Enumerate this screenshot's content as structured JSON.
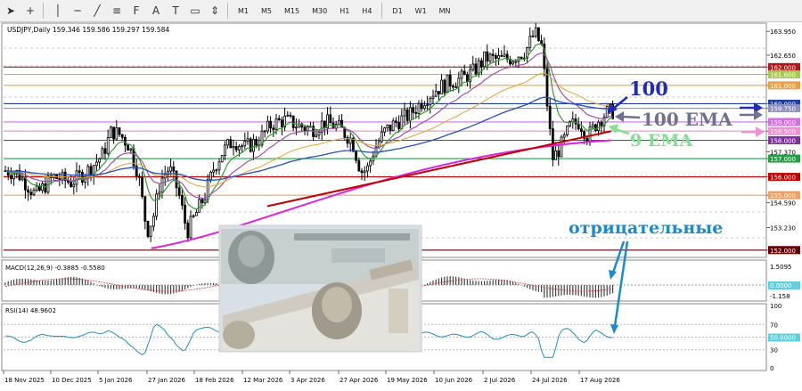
{
  "toolbar": {
    "timeframes": [
      "M1",
      "M5",
      "M15",
      "M30",
      "H1",
      "H4",
      "D1",
      "W1",
      "MN"
    ]
  },
  "chart": {
    "symbol_line": "USDJPY,Daily  159.346 159.586 159.297 159.584",
    "price_axis": [
      "163.950",
      "162.650",
      "162.000",
      "161.600",
      "161.000",
      "160.000",
      "159.750",
      "159.000",
      "158.500",
      "158.000",
      "157.370",
      "157.000",
      "156.000",
      "155.000",
      "154.590",
      "153.230",
      "152.000"
    ],
    "highlighted_prices": [
      {
        "value": "162.000",
        "color": "#b01818"
      },
      {
        "value": "161.600",
        "color": "#a8c850"
      },
      {
        "value": "161.000",
        "color": "#f0a040"
      },
      {
        "value": "160.000",
        "color": "#2040a0"
      },
      {
        "value": "159.750",
        "color": "#9090c0"
      },
      {
        "value": "159.000",
        "color": "#d070e0"
      },
      {
        "value": "158.500",
        "color": "#f090d0"
      },
      {
        "value": "158.000",
        "color": "#8030a0"
      },
      {
        "value": "157.000",
        "color": "#20a040"
      },
      {
        "value": "156.000",
        "color": "#c00000"
      },
      {
        "value": "155.000",
        "color": "#f0a060"
      },
      {
        "value": "152.000",
        "color": "#600000"
      }
    ],
    "date_axis": [
      "18 Nov 2025",
      "10 Dec 2025",
      "5 Jan 2026",
      "27 Jan 2026",
      "18 Feb 2026",
      "12 Mar 2026",
      "3 Apr 2026",
      "27 Apr 2026",
      "19 May 2026",
      "10 Jun 2026",
      "2 Jul 2026",
      "24 Jul 2026",
      "17 Aug 2026"
    ]
  },
  "macd": {
    "label": "MACD(12,26,9) -0.3885 -0.5580",
    "axis": [
      "1.5095",
      "0.0000",
      "-1.158"
    ]
  },
  "rsi": {
    "label": "RSI(14) 48.9602",
    "axis": [
      "100",
      "70",
      "50.0000",
      "30",
      "0"
    ]
  },
  "annotations": {
    "level_100": "100",
    "ema_100": "100 EMA",
    "ema_9": "9 EMA",
    "negative": "отрицательные"
  },
  "colors": {
    "candles": "#000000",
    "ema100": "#2050c0",
    "ema9": "#30a030",
    "ema_orange": "#e8a030",
    "magenta_line": "#e020e0",
    "red_trend": "#c00000",
    "violet_ma": "#a050b0",
    "rsi_line": "#2090c0",
    "annotation_blue": "#1e2ab8",
    "annotation_gray": "#707090",
    "annotation_green": "#80e090",
    "annotation_cyan": "#1a8ad0"
  }
}
